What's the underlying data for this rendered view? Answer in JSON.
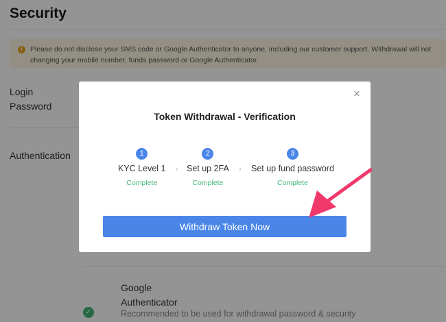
{
  "page": {
    "title": "Security",
    "warning_line1": "Please do not disclose your SMS code or Google Authenticator to anyone, including our customer support. Withdrawal will not",
    "warning_line2": "changing your mobile number, funds password or Google Authenticator.",
    "login_password_label": "Login Password",
    "authentication_label": "Authentication",
    "google_auth_title": "Google Authenticator",
    "google_auth_desc": "Recommended to be used for withdrawal password & security"
  },
  "modal": {
    "title": "Token Withdrawal - Verification",
    "close_glyph": "×",
    "steps": [
      {
        "num": "1",
        "label": "KYC Level 1",
        "status": "Complete"
      },
      {
        "num": "2",
        "label": "Set up 2FA",
        "status": "Complete"
      },
      {
        "num": "3",
        "label": "Set up fund password",
        "status": "Complete"
      }
    ],
    "chevron_glyph": "›",
    "button_label": "Withdraw Token Now"
  },
  "colors": {
    "accent": "#4a86e8",
    "success": "#43b778",
    "annotation_arrow": "#f0386b",
    "warning_bg": "#fdf7e4"
  }
}
